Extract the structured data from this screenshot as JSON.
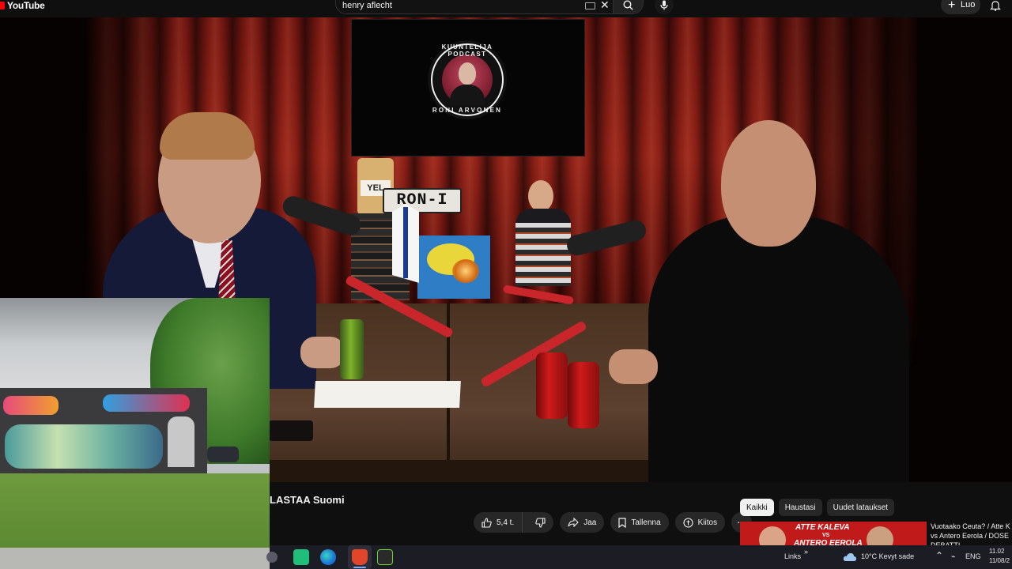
{
  "header": {
    "logo_text": "YouTube",
    "search_value": "henry aflecht",
    "create_label": "Luo"
  },
  "video": {
    "logo_top_text": "KUUNTELIJA PODCAST",
    "logo_bottom_text": "RONI ARVONEN",
    "plate_text": "RON-I",
    "jar_label": "YEL"
  },
  "info": {
    "title": "LASTAA Suomi",
    "like_count": "5,4 t.",
    "share_label": "Jaa",
    "save_label": "Tallenna",
    "thanks_label": "Kiitos",
    "more_label": "⋯"
  },
  "chips": [
    {
      "label": "Kaikki",
      "active": true
    },
    {
      "label": "Haustasi",
      "active": false
    },
    {
      "label": "Uudet lataukset",
      "active": false
    }
  ],
  "recommendation": {
    "thumb_line1": "ATTE KALEVA",
    "thumb_vs": "VS",
    "thumb_line2": "ANTERO EEROLA",
    "title_line1": "Vuotaako Ceuta? / Atte K",
    "title_line2": "vs Antero Eerola / DOSE",
    "title_line3": "DEBATTI"
  },
  "taskbar": {
    "links_label": "Links",
    "links_chevron": "»",
    "weather": "10°C  Kevyt sade",
    "lang": "ENG",
    "time": "11.02",
    "date": "11/08/2"
  },
  "colors": {
    "youtube_red": "#ff0000",
    "background": "#0f0f0f",
    "chip_active_bg": "#f1f1f1",
    "pill_bg": "#272727",
    "curtain": "#8c2016"
  }
}
